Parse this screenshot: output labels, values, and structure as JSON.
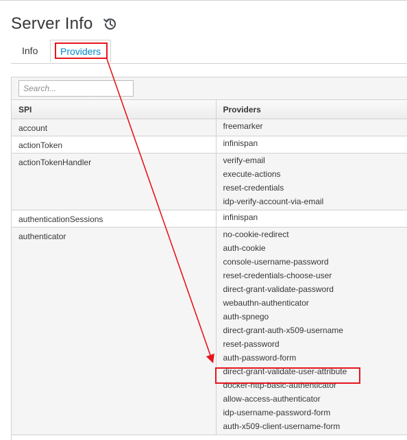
{
  "page": {
    "title": "Server Info",
    "history_icon": "history-icon"
  },
  "tabs": [
    {
      "label": "Info",
      "active": false
    },
    {
      "label": "Providers",
      "active": true
    }
  ],
  "search": {
    "placeholder": "Search...",
    "value": ""
  },
  "table": {
    "columns": [
      "SPI",
      "Providers"
    ],
    "rows": [
      {
        "spi": "account",
        "providers": [
          "freemarker"
        ]
      },
      {
        "spi": "actionToken",
        "providers": [
          "infinispan"
        ]
      },
      {
        "spi": "actionTokenHandler",
        "providers": [
          "verify-email",
          "execute-actions",
          "reset-credentials",
          "idp-verify-account-via-email"
        ]
      },
      {
        "spi": "authenticationSessions",
        "providers": [
          "infinispan"
        ]
      },
      {
        "spi": "authenticator",
        "providers": [
          "no-cookie-redirect",
          "auth-cookie",
          "console-username-password",
          "reset-credentials-choose-user",
          "direct-grant-validate-password",
          "webauthn-authenticator",
          "auth-spnego",
          "direct-grant-auth-x509-username",
          "reset-password",
          "auth-password-form",
          "direct-grant-validate-user-attribute",
          "docker-http-basic-authenticator",
          "allow-access-authenticator",
          "idp-username-password-form",
          "auth-x509-client-username-form"
        ]
      }
    ]
  },
  "annotation": {
    "highlight_color": "#e8141a",
    "highlighted_tab": "Providers",
    "highlighted_provider": "direct-grant-validate-user-attribute"
  },
  "colors": {
    "accent": "#0088ce",
    "border": "#d1d1d1",
    "stripe": "#f5f5f5",
    "text": "#363636"
  }
}
